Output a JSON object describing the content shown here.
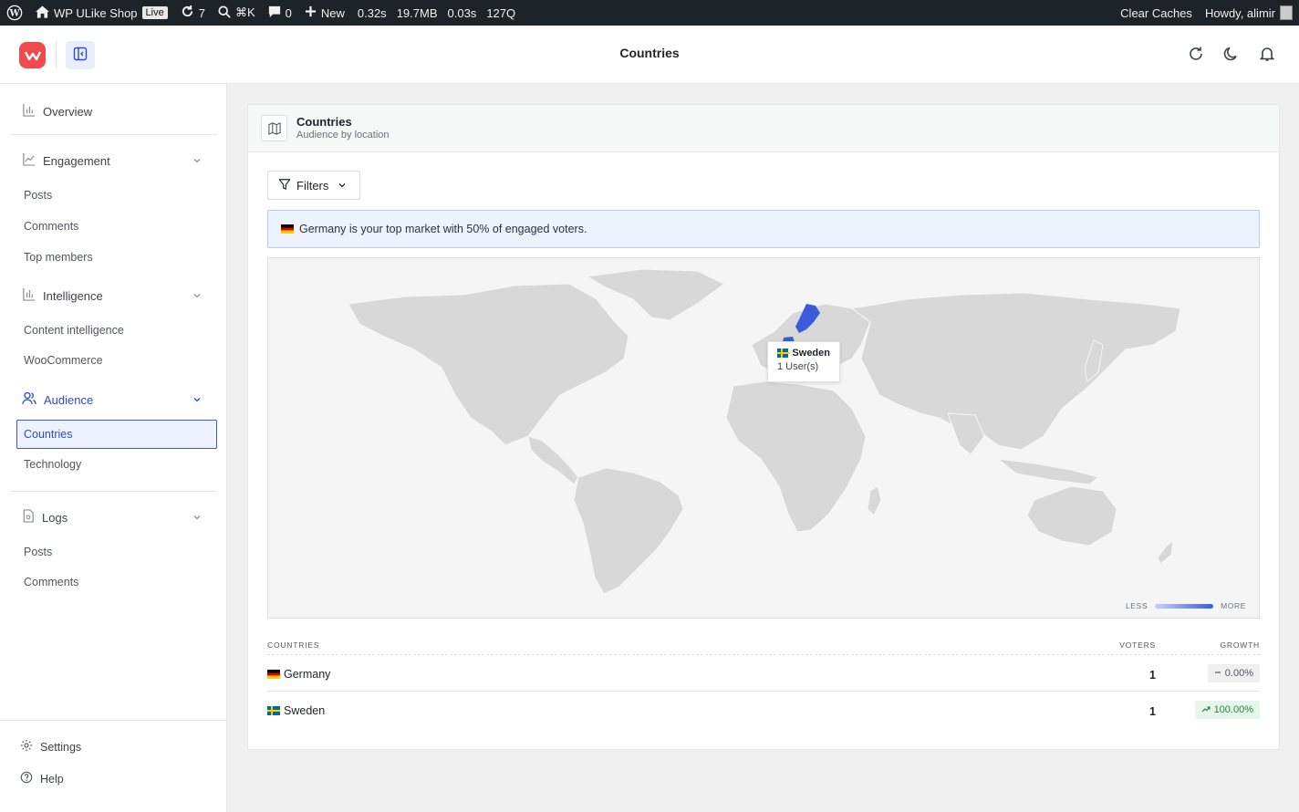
{
  "adminbar": {
    "site_name": "WP ULike Shop",
    "live_badge": "Live",
    "updates_count": "7",
    "search_shortcut": "⌘K",
    "comments_count": "0",
    "new_label": "New",
    "perf": [
      "0.32s",
      "19.7MB",
      "0.03s",
      "127Q"
    ],
    "clear_caches": "Clear Caches",
    "howdy": "Howdy, alimir"
  },
  "header": {
    "title": "Countries"
  },
  "sidebar": {
    "overview": "Overview",
    "engagement": {
      "label": "Engagement",
      "items": [
        "Posts",
        "Comments",
        "Top members"
      ]
    },
    "intelligence": {
      "label": "Intelligence",
      "items": [
        "Content intelligence",
        "WooCommerce"
      ]
    },
    "audience": {
      "label": "Audience",
      "items": [
        "Countries",
        "Technology"
      ],
      "active": "Countries"
    },
    "logs": {
      "label": "Logs",
      "items": [
        "Posts",
        "Comments"
      ]
    },
    "footer": {
      "settings": "Settings",
      "help": "Help"
    }
  },
  "card": {
    "title": "Countries",
    "subtitle": "Audience by location",
    "filters_label": "Filters",
    "insight_text": "Germany is your top market with 50% of engaged voters.",
    "tooltip": {
      "country": "Sweden",
      "value": "1 User(s)"
    },
    "legend": {
      "less": "LESS",
      "more": "MORE"
    },
    "table": {
      "headers": {
        "country": "COUNTRIES",
        "voters": "VOTERS",
        "growth": "GROWTH"
      },
      "rows": [
        {
          "country": "Germany",
          "flag": "de",
          "voters": "1",
          "growth": "0.00%",
          "trend": "neutral"
        },
        {
          "country": "Sweden",
          "flag": "se",
          "voters": "1",
          "growth": "100.00%",
          "trend": "up"
        }
      ]
    }
  },
  "colors": {
    "accent": "#3b5bdb",
    "land": "#d8d8d8",
    "highlight": "#3b5bdb",
    "logo": "#f04a4f"
  },
  "map_highlights": [
    "Sweden",
    "Germany"
  ]
}
